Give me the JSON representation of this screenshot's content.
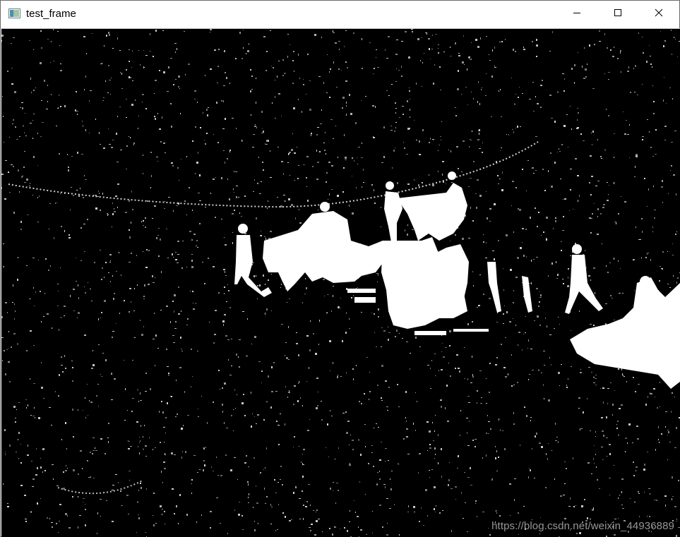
{
  "window": {
    "title": "test_frame",
    "icon": "opencv-window-icon",
    "controls": {
      "minimize_icon": "minimize-icon",
      "maximize_icon": "maximize-icon",
      "close_icon": "close-icon"
    }
  },
  "image": {
    "description_type": "binary-foreground-mask",
    "foreground_color": "#ffffff",
    "background_color": "#000000"
  },
  "watermark": {
    "text": "https://blog.csdn.net/weixin_44936889"
  }
}
